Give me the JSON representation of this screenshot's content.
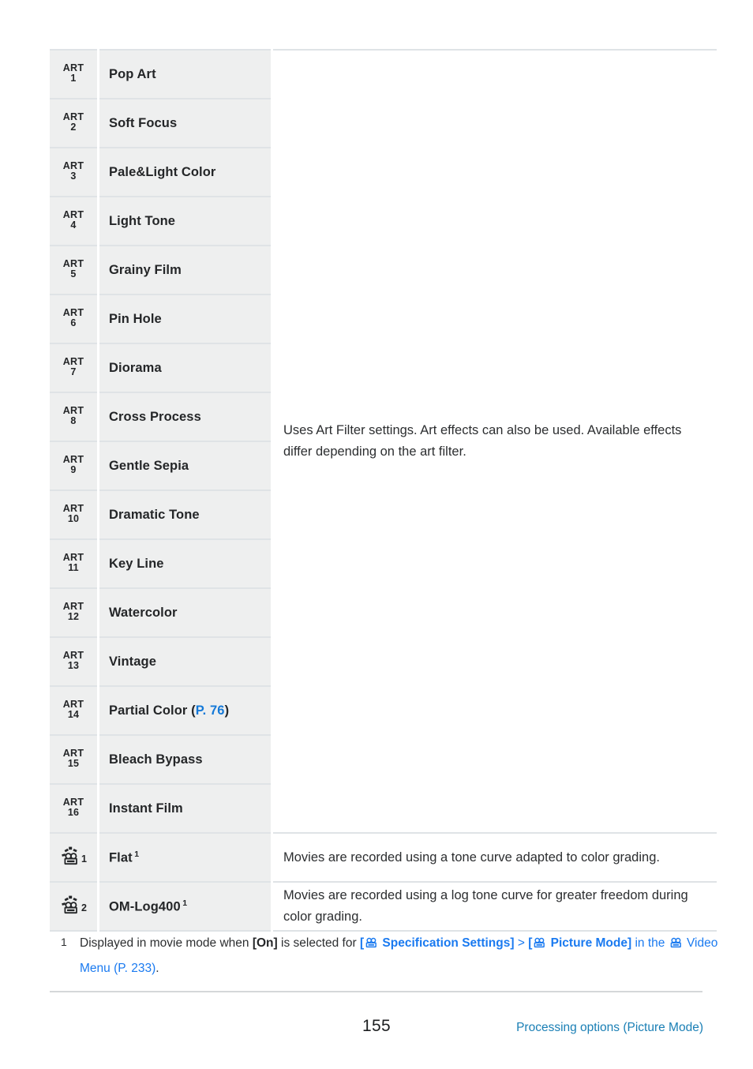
{
  "document": {
    "page_number": "155",
    "footer_chapter": "Processing options (Picture Mode)"
  },
  "table": {
    "art_description": "Uses Art Filter settings. Art effects can also be used. Available effects differ depending on the art filter.",
    "art_rows": [
      {
        "icon": "art-badge-icon",
        "icon_word": "ART",
        "icon_num": "1",
        "name": "Pop Art"
      },
      {
        "icon": "art-badge-icon",
        "icon_word": "ART",
        "icon_num": "2",
        "name": "Soft Focus"
      },
      {
        "icon": "art-badge-icon",
        "icon_word": "ART",
        "icon_num": "3",
        "name": "Pale&Light Color"
      },
      {
        "icon": "art-badge-icon",
        "icon_word": "ART",
        "icon_num": "4",
        "name": "Light Tone"
      },
      {
        "icon": "art-badge-icon",
        "icon_word": "ART",
        "icon_num": "5",
        "name": "Grainy Film"
      },
      {
        "icon": "art-badge-icon",
        "icon_word": "ART",
        "icon_num": "6",
        "name": "Pin Hole"
      },
      {
        "icon": "art-badge-icon",
        "icon_word": "ART",
        "icon_num": "7",
        "name": "Diorama"
      },
      {
        "icon": "art-badge-icon",
        "icon_word": "ART",
        "icon_num": "8",
        "name": "Cross Process"
      },
      {
        "icon": "art-badge-icon",
        "icon_word": "ART",
        "icon_num": "9",
        "name": "Gentle Sepia"
      },
      {
        "icon": "art-badge-icon",
        "icon_word": "ART",
        "icon_num": "10",
        "name": "Dramatic Tone"
      },
      {
        "icon": "art-badge-icon",
        "icon_word": "ART",
        "icon_num": "11",
        "name": "Key Line"
      },
      {
        "icon": "art-badge-icon",
        "icon_word": "ART",
        "icon_num": "12",
        "name": "Watercolor"
      },
      {
        "icon": "art-badge-icon",
        "icon_word": "ART",
        "icon_num": "13",
        "name": "Vintage"
      },
      {
        "icon": "art-badge-icon",
        "icon_word": "ART",
        "icon_num": "14",
        "name": "Partial Color",
        "link_text": "P. 76",
        "link_color": "#1479d8"
      },
      {
        "icon": "art-badge-icon",
        "icon_word": "ART",
        "icon_num": "15",
        "name": "Bleach Bypass"
      },
      {
        "icon": "art-badge-icon",
        "icon_word": "ART",
        "icon_num": "16",
        "name": "Instant Film"
      }
    ],
    "movie_rows": [
      {
        "icon": "movie-camera-sparkle-icon",
        "icon_num": "1",
        "name": "Flat",
        "footnote_mark": "1",
        "description": "Movies are recorded using a tone curve adapted to color grading."
      },
      {
        "icon": "movie-camera-sparkle-icon",
        "icon_num": "2",
        "name": "OM-Log400",
        "footnote_mark": "1",
        "description": "Movies are recorded using a log tone curve for greater freedom during color grading."
      }
    ]
  },
  "footnote": {
    "number": "1",
    "text_1": "Displayed in movie mode when ",
    "bold_on": "[On]",
    "text_2": " is selected for ",
    "bracket_open_1": "[",
    "link_spec": " Specification Settings]",
    "separator": " > ",
    "bracket_open_2": "[",
    "link_picture": " Picture Mode]",
    "text_3": " in the ",
    "video_menu": " Video Menu",
    "page_ref": " (P. 233)",
    "period": ".",
    "link_color": "#1a7af0"
  },
  "colors": {
    "cell_bg": "#eeefef",
    "border": "#dfe3e6",
    "link_blue": "#1a7af0",
    "footer_link": "#1a7fb5",
    "text": "#2c2e30"
  }
}
